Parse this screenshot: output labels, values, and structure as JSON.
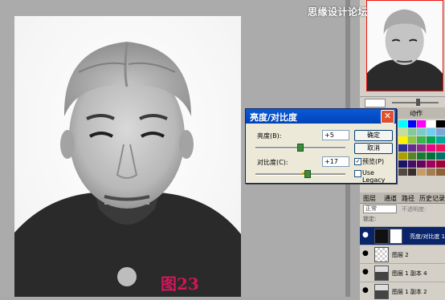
{
  "watermark": "思缘设计论坛",
  "caption": "图23",
  "dialog": {
    "title": "亮度/对比度",
    "brightness_label": "亮度(B):",
    "brightness_value": "+5",
    "contrast_label": "对比度(C):",
    "contrast_value": "+17",
    "ok_label": "确定",
    "cancel_label": "取消",
    "preview_label": "预览(P)",
    "legacy_label": "Use Legacy"
  },
  "swatches": {
    "tabs": [
      "样式",
      "动作"
    ]
  },
  "layers": {
    "tabs": [
      "图层",
      "通道",
      "路径",
      "历史记录"
    ],
    "blend_mode": "正常",
    "opacity_label": "不透明度:",
    "lock_label": "锁定:",
    "items": [
      {
        "name": "亮度/对比度 1",
        "active": true
      },
      {
        "name": "图层 2"
      },
      {
        "name": "图层 1 副本 4"
      },
      {
        "name": "图层 1 副本 2"
      }
    ]
  }
}
